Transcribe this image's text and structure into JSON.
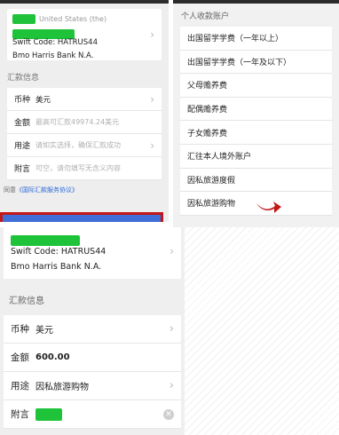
{
  "panel_top_left": {
    "bank_card": {
      "country": "United States (the)",
      "swift": "Swift Code: HATRUS44",
      "bank_name": "Bmo Harris Bank N.A."
    },
    "section_title": "汇款信息",
    "rows": [
      {
        "label": "币种",
        "value": "美元",
        "placeholder": ""
      },
      {
        "label": "金额",
        "value": "",
        "placeholder": "最高可汇款49974.24美元"
      },
      {
        "label": "用途",
        "value": "",
        "placeholder": "请如实选择，确保汇款成功"
      },
      {
        "label": "附言",
        "value": "",
        "placeholder": "可空，请勿填写无含义内容"
      }
    ],
    "agree_prefix": "同意",
    "agree_link": "《国际汇款服务协议》"
  },
  "panel_top_right": {
    "header": "个人收款账户",
    "items": [
      "出国留学学费（一年以上）",
      "出国留学学费（一年及以下）",
      "父母赡养费",
      "配偶赡养费",
      "子女赡养费",
      "汇往本人境外账户",
      "因私旅游度假",
      "因私旅游购物"
    ]
  },
  "panel_bottom_left": {
    "bank_card": {
      "swift": "Swift Code: HATRUS44",
      "bank_name": "Bmo Harris Bank N.A."
    },
    "section_title": "汇款信息",
    "rows": [
      {
        "label": "币种",
        "value": "美元"
      },
      {
        "label": "金额",
        "value": "600.00"
      },
      {
        "label": "用途",
        "value": "因私旅游购物"
      },
      {
        "label": "附言",
        "value": ""
      }
    ]
  },
  "colors": {
    "redact_green": "#1ec33a",
    "link_blue": "#2d6bd6",
    "highlight_red": "#c31717",
    "arrow_red": "#c11818"
  }
}
